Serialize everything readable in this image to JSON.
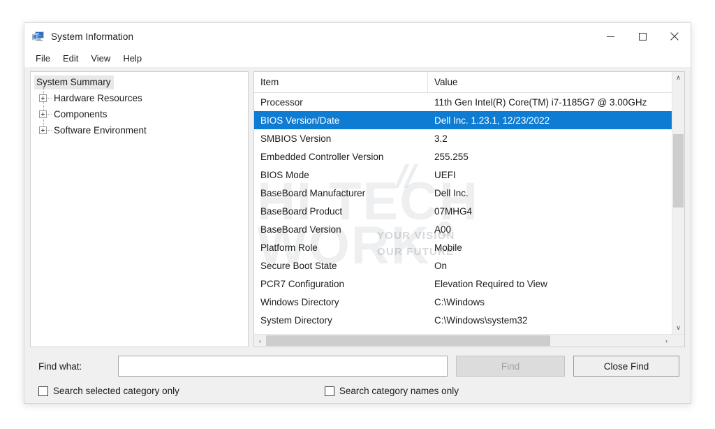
{
  "window": {
    "title": "System Information",
    "icon": "computer-icon",
    "controls": {
      "minimize": "–",
      "maximize": "☐",
      "close": "✕"
    }
  },
  "menubar": {
    "items": [
      {
        "label": "File"
      },
      {
        "label": "Edit"
      },
      {
        "label": "View"
      },
      {
        "label": "Help"
      }
    ]
  },
  "tree": {
    "root": "System Summary",
    "nodes": [
      {
        "label": "Hardware Resources",
        "expander": "plus-icon"
      },
      {
        "label": "Components",
        "expander": "plus-icon"
      },
      {
        "label": "Software Environment",
        "expander": "plus-icon"
      }
    ]
  },
  "table": {
    "columns": [
      "Item",
      "Value"
    ],
    "selected_index": 1,
    "rows": [
      {
        "item": "Processor",
        "value": "11th Gen Intel(R) Core(TM) i7-1185G7 @ 3.00GHz"
      },
      {
        "item": "BIOS Version/Date",
        "value": "Dell Inc. 1.23.1, 12/23/2022"
      },
      {
        "item": "SMBIOS Version",
        "value": "3.2"
      },
      {
        "item": "Embedded Controller Version",
        "value": "255.255"
      },
      {
        "item": "BIOS Mode",
        "value": "UEFI"
      },
      {
        "item": "BaseBoard Manufacturer",
        "value": "Dell Inc."
      },
      {
        "item": "BaseBoard Product",
        "value": "07MHG4"
      },
      {
        "item": "BaseBoard Version",
        "value": "A00"
      },
      {
        "item": "Platform Role",
        "value": "Mobile"
      },
      {
        "item": "Secure Boot State",
        "value": "On"
      },
      {
        "item": "PCR7 Configuration",
        "value": "Elevation Required to View"
      },
      {
        "item": "Windows Directory",
        "value": "C:\\Windows"
      },
      {
        "item": "System Directory",
        "value": "C:\\Windows\\system32"
      }
    ]
  },
  "scrollbars": {
    "vertical": {
      "up": "∧",
      "down": "∨"
    },
    "horizontal": {
      "left": "‹",
      "right": "›"
    }
  },
  "findbar": {
    "label": "Find what:",
    "input_value": "",
    "input_placeholder": "",
    "find_button": "Find",
    "close_find_button": "Close Find",
    "checkbox_selected_category": "Search selected category only",
    "checkbox_category_names": "Search category names only"
  },
  "watermark": {
    "line1": "HI TECH",
    "line2": "WORK",
    "tagline1": "YOUR VISION",
    "tagline2": "OUR FUTURE"
  },
  "colors": {
    "selection": "#0f7cd4",
    "window_bg": "#f0f0f0",
    "pane_bg": "#ffffff",
    "scrollbar_thumb": "#cdcdcd"
  }
}
